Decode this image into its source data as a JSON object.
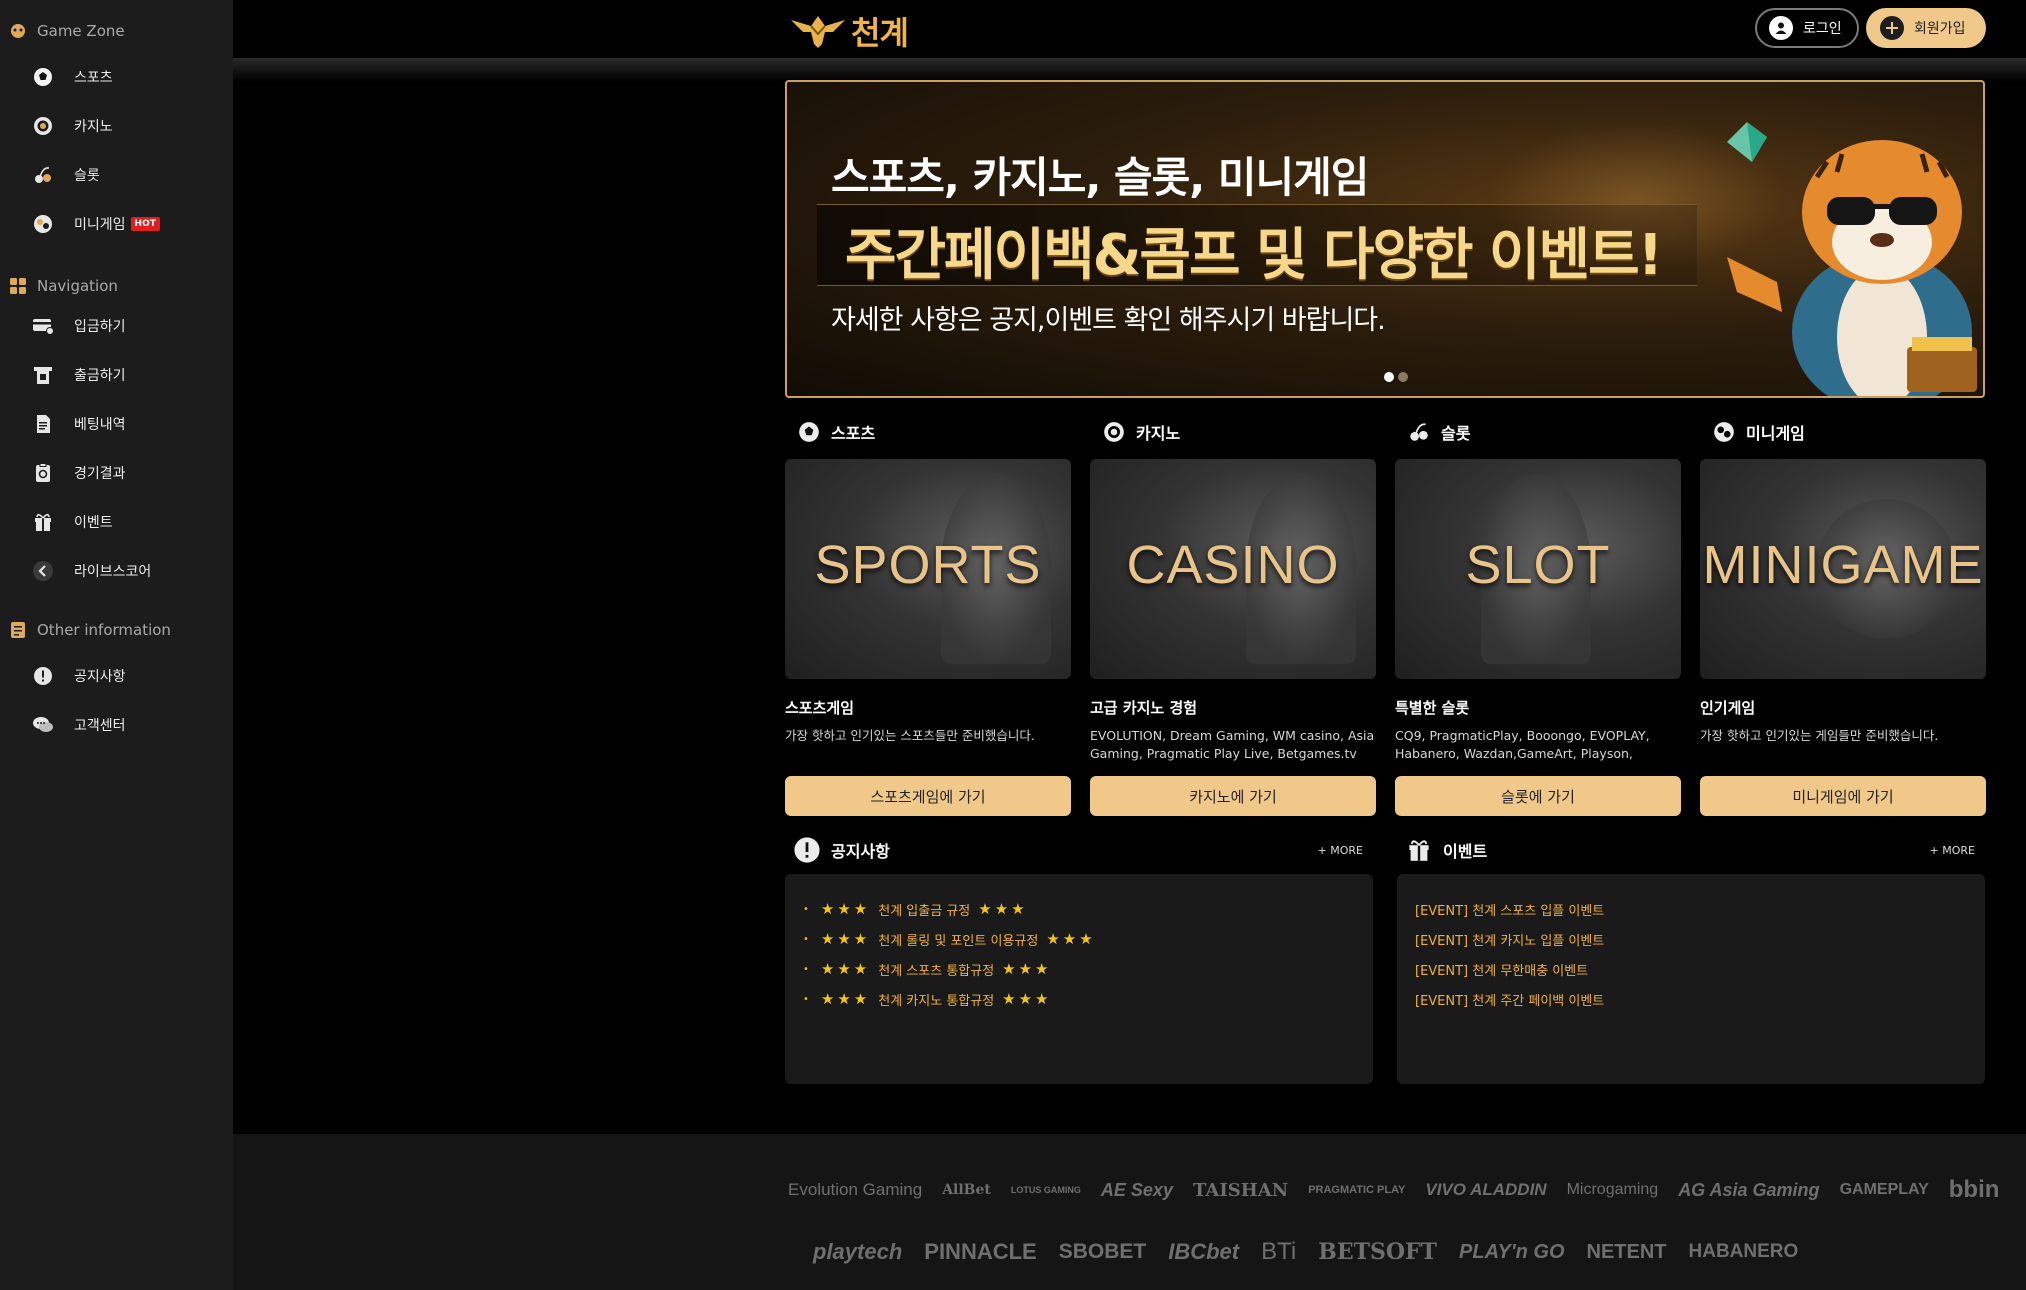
{
  "sidebar": {
    "game_zone": {
      "title": "Game Zone",
      "items": [
        {
          "label": "스포츠"
        },
        {
          "label": "카지노"
        },
        {
          "label": "슬롯"
        },
        {
          "label": "미니게임",
          "badge": "HOT"
        }
      ]
    },
    "navigation": {
      "title": "Navigation",
      "items": [
        {
          "label": "입금하기"
        },
        {
          "label": "출금하기"
        },
        {
          "label": "베팅내역"
        },
        {
          "label": "경기결과"
        },
        {
          "label": "이벤트"
        },
        {
          "label": "라이브스코어"
        }
      ]
    },
    "other": {
      "title": "Other information",
      "items": [
        {
          "label": "공지사항"
        },
        {
          "label": "고객센터"
        }
      ]
    }
  },
  "header": {
    "logo_text": "천계",
    "login_label": "로그인",
    "join_label": "회원가입"
  },
  "banner": {
    "line1": "스포츠, 카지노, 슬롯, 미니게임",
    "line2": "주간페이백&콤프 및 다양한 이벤트!",
    "line3": "자세한 사항은 공지,이벤트 확인 해주시기 바랍니다.",
    "slides_total": 2,
    "active_slide": 1
  },
  "categories": [
    {
      "header": "스포츠",
      "image_word": "SPORTS",
      "title": "스포츠게임",
      "desc": "가장 핫하고 인기있는 스포츠들만 준비했습니다.",
      "button": "스포츠게임에 가기"
    },
    {
      "header": "카지노",
      "image_word": "CASINO",
      "title": "고급 카지노 경험",
      "desc": "EVOLUTION, Dream Gaming, WM casino, Asia Gaming, Pragmatic Play Live, Betgames.tv 등...",
      "button": "카지노에 가기"
    },
    {
      "header": "슬롯",
      "image_word": "SLOT",
      "title": "특별한 슬롯",
      "desc": "CQ9, PragmaticPlay, Booongo, EVOPLAY, Habanero, Wazdan,GameArt, Playson, Triple...",
      "button": "슬롯에 가기"
    },
    {
      "header": "미니게임",
      "image_word": "MINIGAME",
      "title": "인기게임",
      "desc": "가장 핫하고 인기있는 게임들만 준비했습니다.",
      "button": "미니게임에 가기"
    }
  ],
  "notice": {
    "title": "공지사항",
    "more": "+ MORE",
    "items": [
      {
        "text": "천계 입출금 규정"
      },
      {
        "text": "천계 롤링 및 포인트 이용규정"
      },
      {
        "text": "천계 스포츠 통합규정"
      },
      {
        "text": "천계 카지노 통합규정"
      }
    ]
  },
  "events": {
    "title": "이벤트",
    "more": "+ MORE",
    "items": [
      {
        "text": "[EVENT] 천계 스포츠 입플 이벤트"
      },
      {
        "text": "[EVENT] 천계 카지노 입플 이벤트"
      },
      {
        "text": "[EVENT] 천계 무한매충 이벤트"
      },
      {
        "text": "[EVENT] 천계 주간 페이백 이벤트"
      }
    ]
  },
  "providers": {
    "row1": [
      "Evolution Gaming",
      "AllBet",
      "LOTUS GAMING",
      "AE Sexy",
      "TAISHAN",
      "PRAGMATIC PLAY",
      "VIVO ALADDIN",
      "Microgaming",
      "AG Asia Gaming",
      "GAMEPLAY",
      "bbin"
    ],
    "row2": [
      "playtech",
      "PINNACLE",
      "SBOBET",
      "IBCbet",
      "BTi",
      "BETSOFT",
      "PLAY'n GO",
      "NETENT",
      "HABANERO"
    ]
  },
  "colors": {
    "accent": "#f0c98a",
    "gold_text": "#f0b040",
    "sidebar_bg": "#1c1c1c",
    "hot_badge": "#e21d1d"
  }
}
